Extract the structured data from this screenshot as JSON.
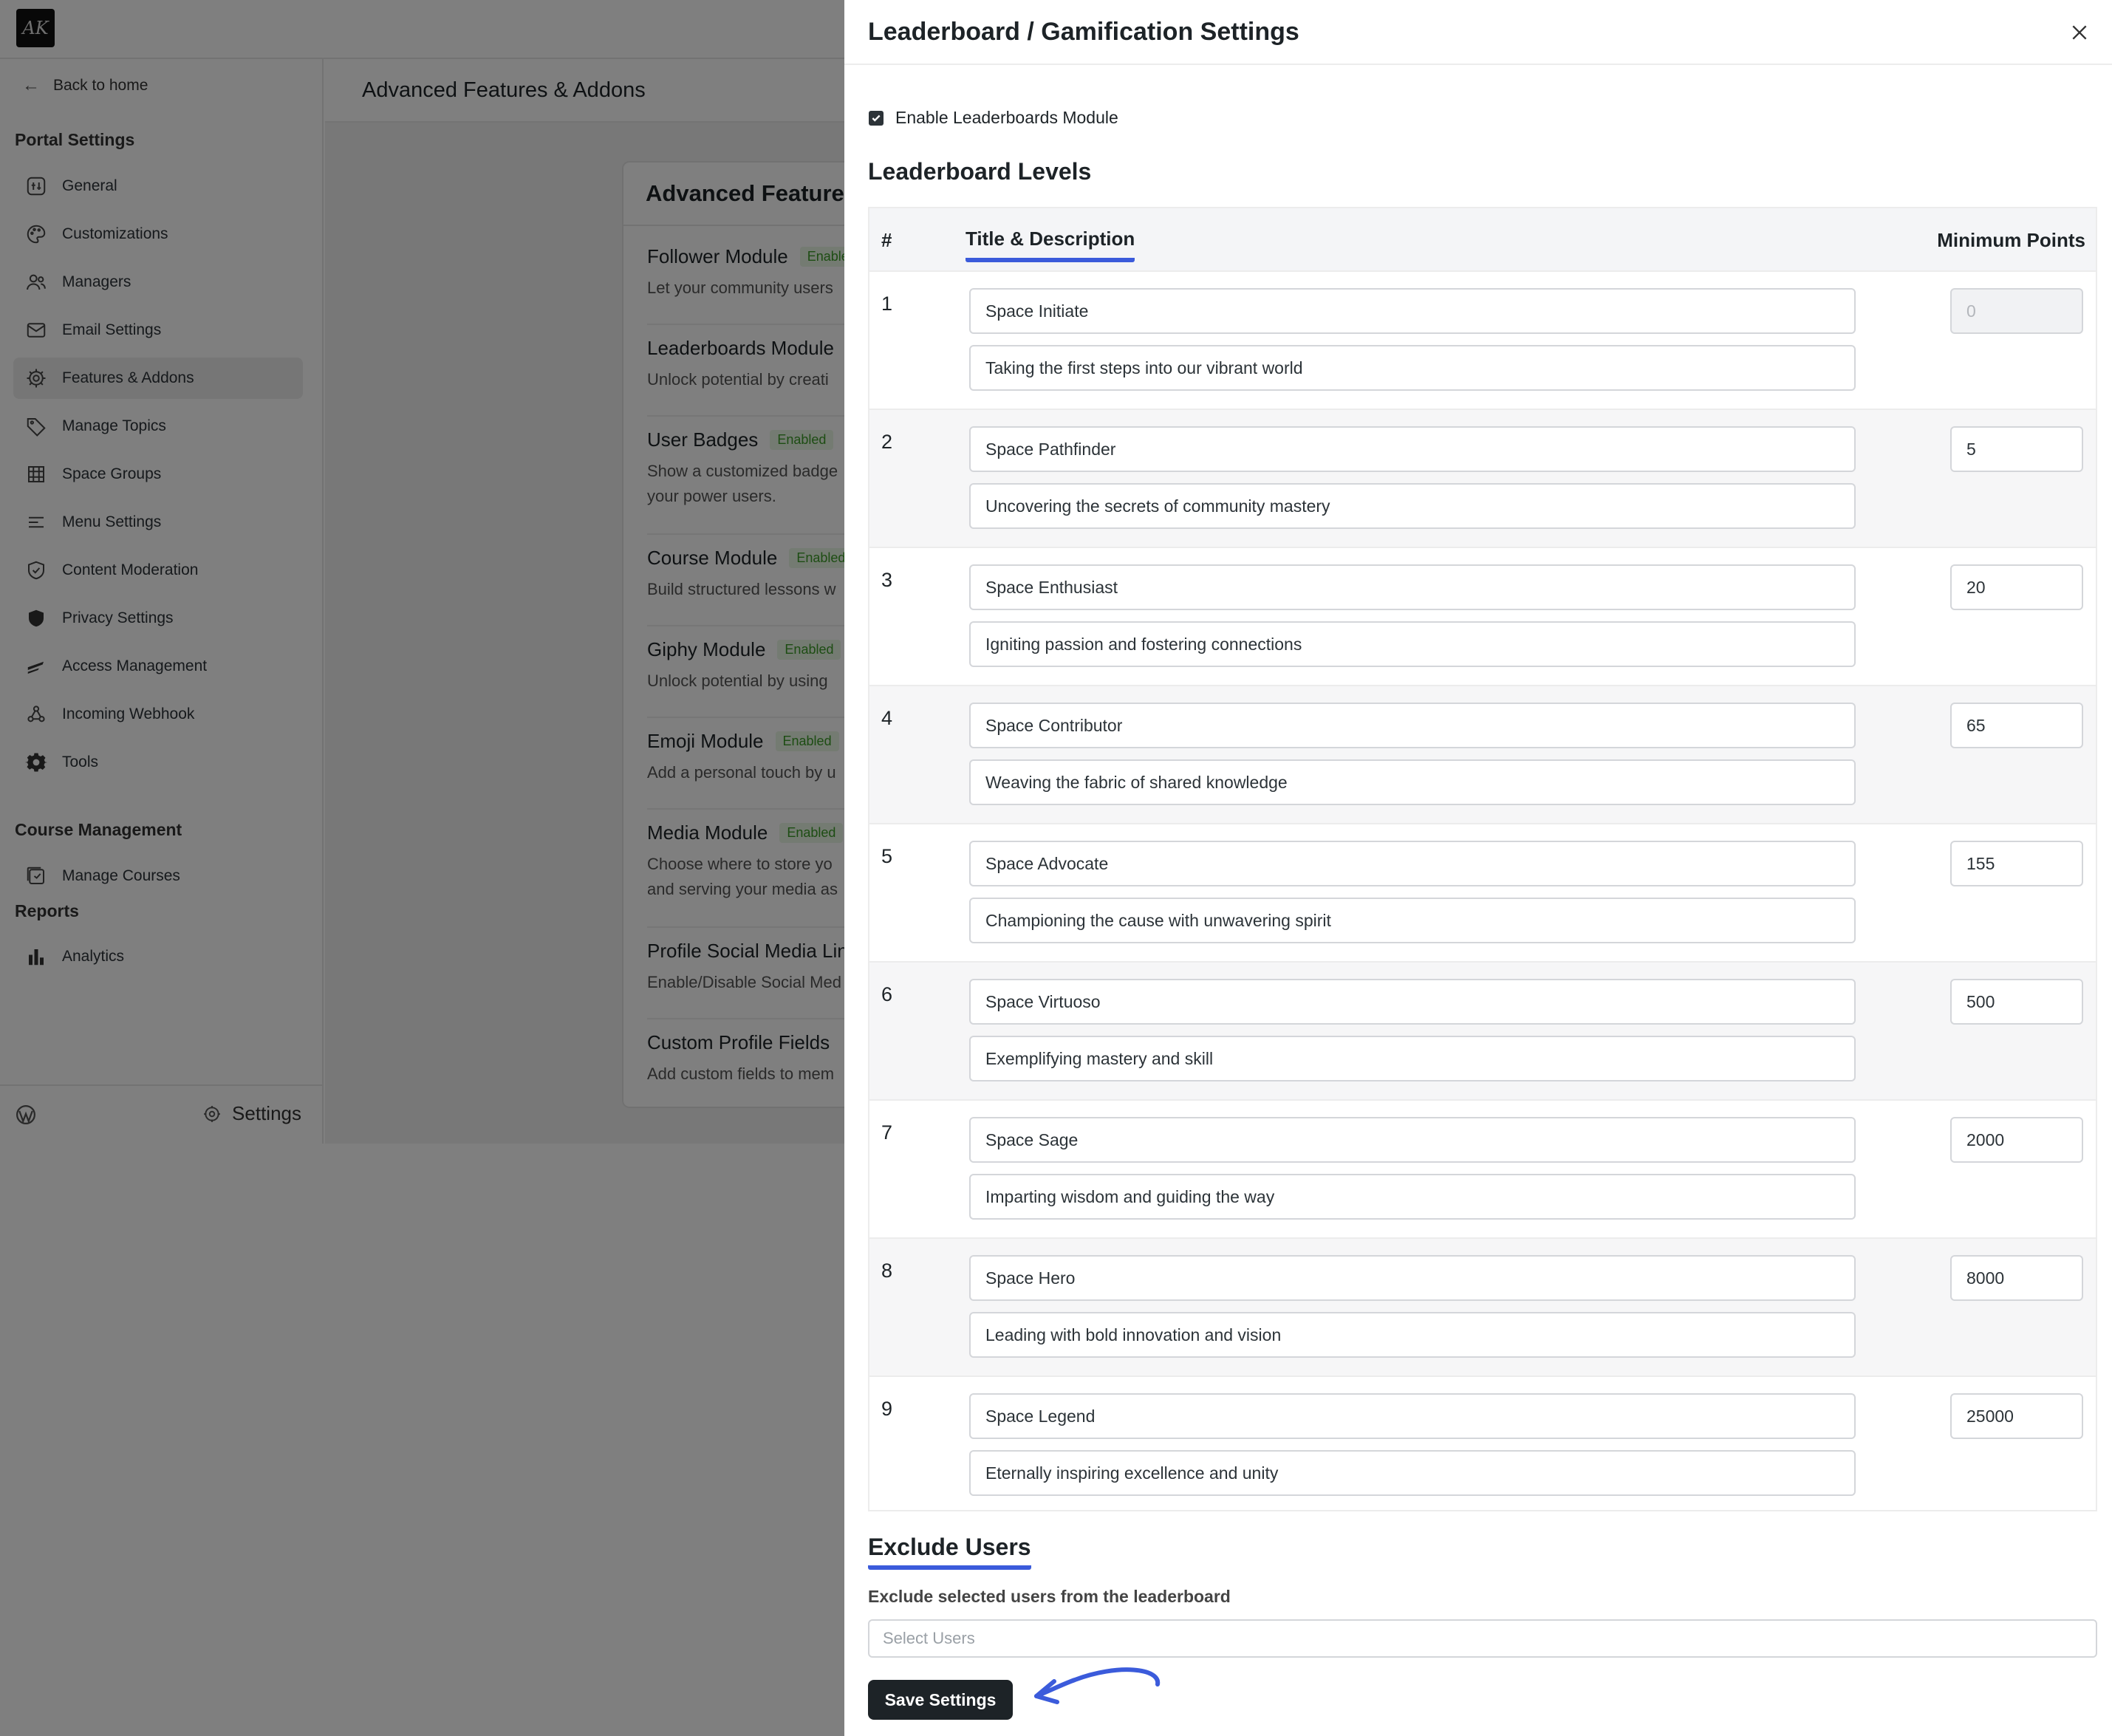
{
  "app": {
    "logo_text": "AK"
  },
  "sidebar": {
    "back_label": "Back to home",
    "portal_section": "Portal Settings",
    "items": [
      {
        "label": "General",
        "icon": "general-icon"
      },
      {
        "label": "Customizations",
        "icon": "palette-icon"
      },
      {
        "label": "Managers",
        "icon": "users-icon"
      },
      {
        "label": "Email Settings",
        "icon": "email-icon"
      },
      {
        "label": "Features & Addons",
        "icon": "gear-icon",
        "active": true
      },
      {
        "label": "Manage Topics",
        "icon": "tag-icon"
      },
      {
        "label": "Space Groups",
        "icon": "grid-icon"
      },
      {
        "label": "Menu Settings",
        "icon": "menu-icon"
      },
      {
        "label": "Content Moderation",
        "icon": "shield-check-icon"
      },
      {
        "label": "Privacy Settings",
        "icon": "shield-icon"
      },
      {
        "label": "Access Management",
        "icon": "key-icon"
      },
      {
        "label": "Incoming Webhook",
        "icon": "webhook-icon"
      },
      {
        "label": "Tools",
        "icon": "cog-icon"
      }
    ],
    "course_section": "Course Management",
    "course_items": [
      {
        "label": "Manage Courses",
        "icon": "courses-icon"
      }
    ],
    "reports_section": "Reports",
    "report_items": [
      {
        "label": "Analytics",
        "icon": "bar-chart-icon"
      }
    ],
    "footer_settings": "Settings"
  },
  "main": {
    "title": "Advanced Features & Addons",
    "card_title": "Advanced Features",
    "features": [
      {
        "name": "Follower Module",
        "badge": "Enabled",
        "desc": "Let your community users"
      },
      {
        "name": "Leaderboards Module",
        "badge": "",
        "desc": "Unlock potential by creati"
      },
      {
        "name": "User Badges",
        "badge": "Enabled",
        "desc": "Show a customized badge",
        "desc2": "your power users."
      },
      {
        "name": "Course Module",
        "badge": "Enabled",
        "desc": "Build structured lessons w"
      },
      {
        "name": "Giphy Module",
        "badge": "Enabled",
        "desc": "Unlock potential by using"
      },
      {
        "name": "Emoji Module",
        "badge": "Enabled",
        "desc": "Add a personal touch by u"
      },
      {
        "name": "Media Module",
        "badge": "Enabled",
        "desc": "Choose where to store yo",
        "desc2": "and serving your media as"
      },
      {
        "name": "Profile Social Media Lin",
        "badge": "",
        "desc": "Enable/Disable Social Med"
      },
      {
        "name": "Custom Profile Fields",
        "badge": "",
        "desc": "Add custom fields to mem"
      }
    ]
  },
  "drawer": {
    "title": "Leaderboard / Gamification Settings",
    "enable_label": "Enable Leaderboards Module",
    "enable_checked": true,
    "levels_heading": "Leaderboard Levels",
    "col_num": "#",
    "col_title": "Title & Description",
    "col_points": "Minimum Points",
    "levels": [
      {
        "num": "1",
        "title": "Space Initiate",
        "desc": "Taking the first steps into our vibrant world",
        "points": "0"
      },
      {
        "num": "2",
        "title": "Space Pathfinder",
        "desc": "Uncovering the secrets of community mastery",
        "points": "5"
      },
      {
        "num": "3",
        "title": "Space Enthusiast",
        "desc": "Igniting passion and fostering connections",
        "points": "20"
      },
      {
        "num": "4",
        "title": "Space Contributor",
        "desc": "Weaving the fabric of shared knowledge",
        "points": "65"
      },
      {
        "num": "5",
        "title": "Space Advocate",
        "desc": "Championing the cause with unwavering spirit",
        "points": "155"
      },
      {
        "num": "6",
        "title": "Space Virtuoso",
        "desc": "Exemplifying mastery and skill",
        "points": "500"
      },
      {
        "num": "7",
        "title": "Space Sage",
        "desc": "Imparting wisdom and guiding the way",
        "points": "2000"
      },
      {
        "num": "8",
        "title": "Space Hero",
        "desc": "Leading with bold innovation and vision",
        "points": "8000"
      },
      {
        "num": "9",
        "title": "Space Legend",
        "desc": "Eternally inspiring excellence and unity",
        "points": "25000"
      }
    ],
    "exclude_heading": "Exclude Users",
    "exclude_label": "Exclude selected users from the leaderboard",
    "exclude_placeholder": "Select Users",
    "save_label": "Save Settings"
  },
  "colors": {
    "accent": "#3b5bdb",
    "enabled_badge": "#3a9a26",
    "dark_button": "#1d2327"
  }
}
